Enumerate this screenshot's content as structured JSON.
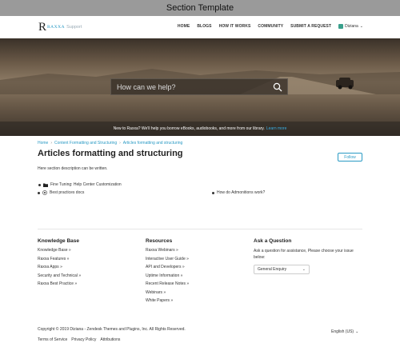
{
  "window": {
    "title": "Section Template"
  },
  "brand": {
    "logo_letter": "R",
    "logo_text": "RAXXA",
    "logo_sub": "Support",
    "accent": "#2a9ac4"
  },
  "nav": {
    "items": [
      "HOME",
      "BLOGS",
      "HOW IT WORKS",
      "COMMUNITY",
      "SUBMIT A REQUEST"
    ],
    "user_name": "Diziana"
  },
  "hero": {
    "search_placeholder": "How can we help?",
    "notice_text": "New to Raxxa? We'll help you borrow eBooks, audiobooks, and more from our library.",
    "notice_link": "Learn more"
  },
  "breadcrumbs": [
    "Home",
    "Content Formatting and Structuring",
    "Articles formatting and structuring"
  ],
  "section": {
    "title": "Articles formatting and structuring",
    "follow_label": "Follow",
    "description": "Here section description can be written."
  },
  "items": {
    "folder": "Fine Tuning: Help Center Customization",
    "doc": "Best practices docs",
    "article": "How do Admonitions work?"
  },
  "footer": {
    "knowledge_base": {
      "title": "Knowledge Base",
      "links": [
        "Knowledge Base »",
        "Raxxa Features »",
        "Raxxa Apps »",
        "Security and Technical »",
        "Raxxa Best Practice »"
      ]
    },
    "resources": {
      "title": "Resources",
      "links": [
        "Raxxa Webinars »",
        "Interactive User Guide »",
        "API and Developers »",
        "Uptime Information »",
        "Recent Release Notes »",
        "Webinars »",
        "White Papers »"
      ]
    },
    "ask": {
      "title": "Ask a Question",
      "text": "Ask a question for assistance, Please choose your issue below:",
      "select_value": "General Enquiry"
    },
    "copyright": "Copyright © 2019 Diziana - Zendesk Themes and Plugins, Inc. All Rights Reserved.",
    "language": "English (US)",
    "bottom_links": [
      "Terms of Service",
      "Privacy Policy",
      "Attributions"
    ]
  }
}
